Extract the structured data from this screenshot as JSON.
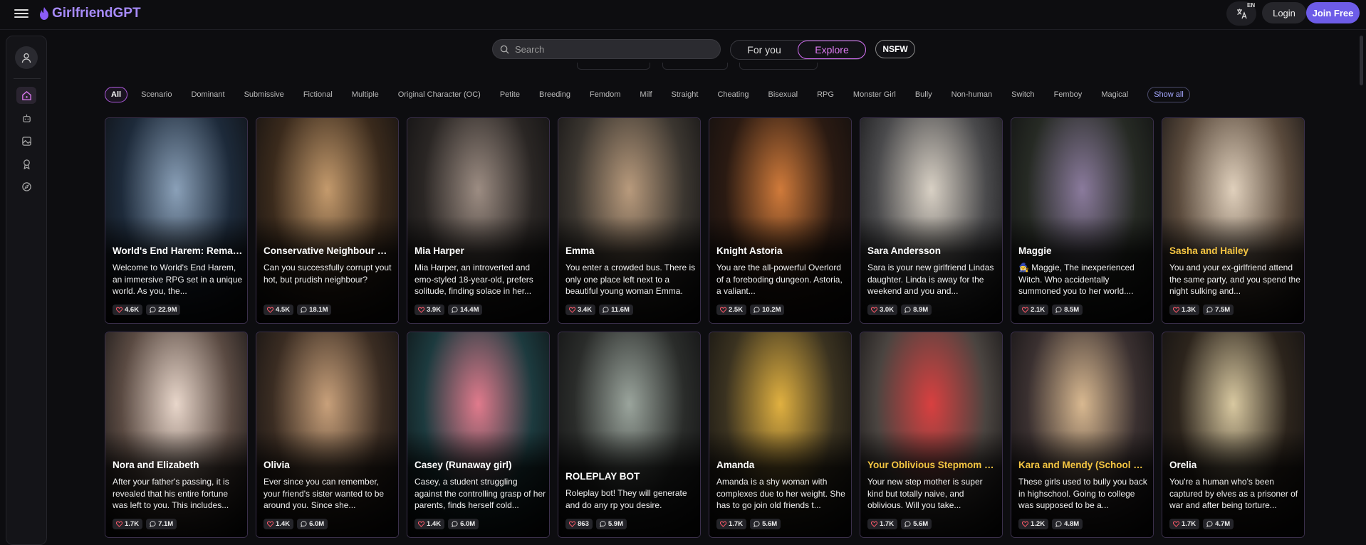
{
  "brand": {
    "name": "GirlfriendGPT"
  },
  "header": {
    "lang_code": "EN",
    "login_label": "Login",
    "join_label": "Join Free"
  },
  "search": {
    "placeholder": "Search"
  },
  "modes": {
    "for_you": "For you",
    "explore": "Explore",
    "nsfw": "NSFW",
    "active": "Explore"
  },
  "categories": [
    "All",
    "Scenario",
    "Dominant",
    "Submissive",
    "Fictional",
    "Multiple",
    "Original Character (OC)",
    "Petite",
    "Breeding",
    "Femdom",
    "Milf",
    "Straight",
    "Cheating",
    "Bisexual",
    "RPG",
    "Monster Girl",
    "Bully",
    "Non-human",
    "Switch",
    "Femboy",
    "Magical"
  ],
  "show_all_label": "Show all",
  "sidebar_icons": [
    "user-icon",
    "home-icon",
    "bot-icon",
    "image-icon",
    "award-icon",
    "compass-icon"
  ],
  "cards": [
    {
      "title": "World's End Harem: Remaster",
      "desc": "Welcome to World's End Harem, an immersive RPG set in a unique world. As you, the...",
      "likes": "4.6K",
      "chats": "22.9M",
      "gold": false,
      "colors": [
        "#1d2a3a",
        "#8aa0b8"
      ]
    },
    {
      "title": "Conservative Neighbour Mom",
      "desc": "Can you successfully corrupt yout hot, but prudish neighbour?",
      "likes": "4.5K",
      "chats": "18.1M",
      "gold": false,
      "colors": [
        "#3a2a1c",
        "#c49a6c"
      ]
    },
    {
      "title": "Mia Harper",
      "desc": "Mia Harper, an introverted and emo-styled 18-year-old, prefers solitude, finding solace in her...",
      "likes": "3.9K",
      "chats": "14.4M",
      "gold": false,
      "colors": [
        "#2a2624",
        "#9c8c82"
      ]
    },
    {
      "title": "Emma",
      "desc": "You enter a crowded bus. There is only one place left next to a beautiful young woman Emma.",
      "likes": "3.4K",
      "chats": "11.6M",
      "gold": false,
      "colors": [
        "#3b3630",
        "#b89a7c"
      ]
    },
    {
      "title": "Knight Astoria",
      "desc": "You are the all-powerful Overlord of a foreboding dungeon. Astoria, a valiant...",
      "likes": "2.5K",
      "chats": "10.2M",
      "gold": false,
      "colors": [
        "#2a1a12",
        "#d07a3a"
      ]
    },
    {
      "title": "Sara Andersson",
      "desc": "Sara is your new girlfriend Lindas daughter. Linda is away for the weekend and you and...",
      "likes": "3.0K",
      "chats": "8.9M",
      "gold": false,
      "colors": [
        "#4a4a4c",
        "#d8d0c4"
      ]
    },
    {
      "title": "Maggie",
      "desc": "🧙‍♀️ Maggie, The inexperienced Witch. Who accidentally summoned you to her world....",
      "likes": "2.1K",
      "chats": "8.5M",
      "gold": false,
      "colors": [
        "#262a24",
        "#8a7a9c"
      ]
    },
    {
      "title": "Sasha and Hailey",
      "desc": "You and your ex-girlfriend attend the same party, and you spend the night sulking and...",
      "likes": "1.3K",
      "chats": "7.5M",
      "gold": true,
      "colors": [
        "#5a4a3c",
        "#e0d0bc"
      ]
    },
    {
      "title": "Nora and Elizabeth",
      "desc": "After your father's passing, it is revealed that his entire fortune was left to you. This includes...",
      "likes": "1.7K",
      "chats": "7.1M",
      "gold": false,
      "colors": [
        "#5a4a42",
        "#e8d6ca"
      ]
    },
    {
      "title": "Olivia",
      "desc": "Ever since you can remember, your friend's sister wanted to be around you. Since she...",
      "likes": "1.4K",
      "chats": "6.0M",
      "gold": false,
      "colors": [
        "#3a2c22",
        "#c8a07a"
      ]
    },
    {
      "title": "Casey (Runaway girl)",
      "desc": "Casey, a student struggling against the controlling grasp of her parents, finds herself cold...",
      "likes": "1.4K",
      "chats": "6.0M",
      "gold": false,
      "colors": [
        "#1c3a3e",
        "#e07a8c"
      ]
    },
    {
      "title": "ROLEPLAY BOT",
      "desc": "Roleplay bot! They will generate and do any rp you desire.",
      "likes": "863",
      "chats": "5.9M",
      "gold": false,
      "low": true,
      "colors": [
        "#2a2c2a",
        "#9aa49c"
      ]
    },
    {
      "title": "Amanda",
      "desc": "Amanda is a shy woman with complexes due to her weight. She has to go join old friends t...",
      "likes": "1.7K",
      "chats": "5.6M",
      "gold": false,
      "colors": [
        "#3a3220",
        "#e0b040"
      ]
    },
    {
      "title": "Your Oblivious Stepmom Jenna",
      "desc": "Your new step mother is super kind but totally naive, and oblivious. Will you take...",
      "likes": "1.7K",
      "chats": "5.6M",
      "gold": true,
      "colors": [
        "#4a4440",
        "#d84040"
      ]
    },
    {
      "title": "Kara and Mendy (School bullies)",
      "desc": "These girls used to bully you back in highschool. Going to college was supposed to be a...",
      "likes": "1.2K",
      "chats": "4.8M",
      "gold": true,
      "colors": [
        "#3a3030",
        "#d8b890"
      ]
    },
    {
      "title": "Orelia",
      "desc": "You're a human who's been captured by elves as a prisoner of war and after being torture...",
      "likes": "1.7K",
      "chats": "4.7M",
      "gold": false,
      "colors": [
        "#2c241c",
        "#d8c8a0"
      ]
    }
  ]
}
